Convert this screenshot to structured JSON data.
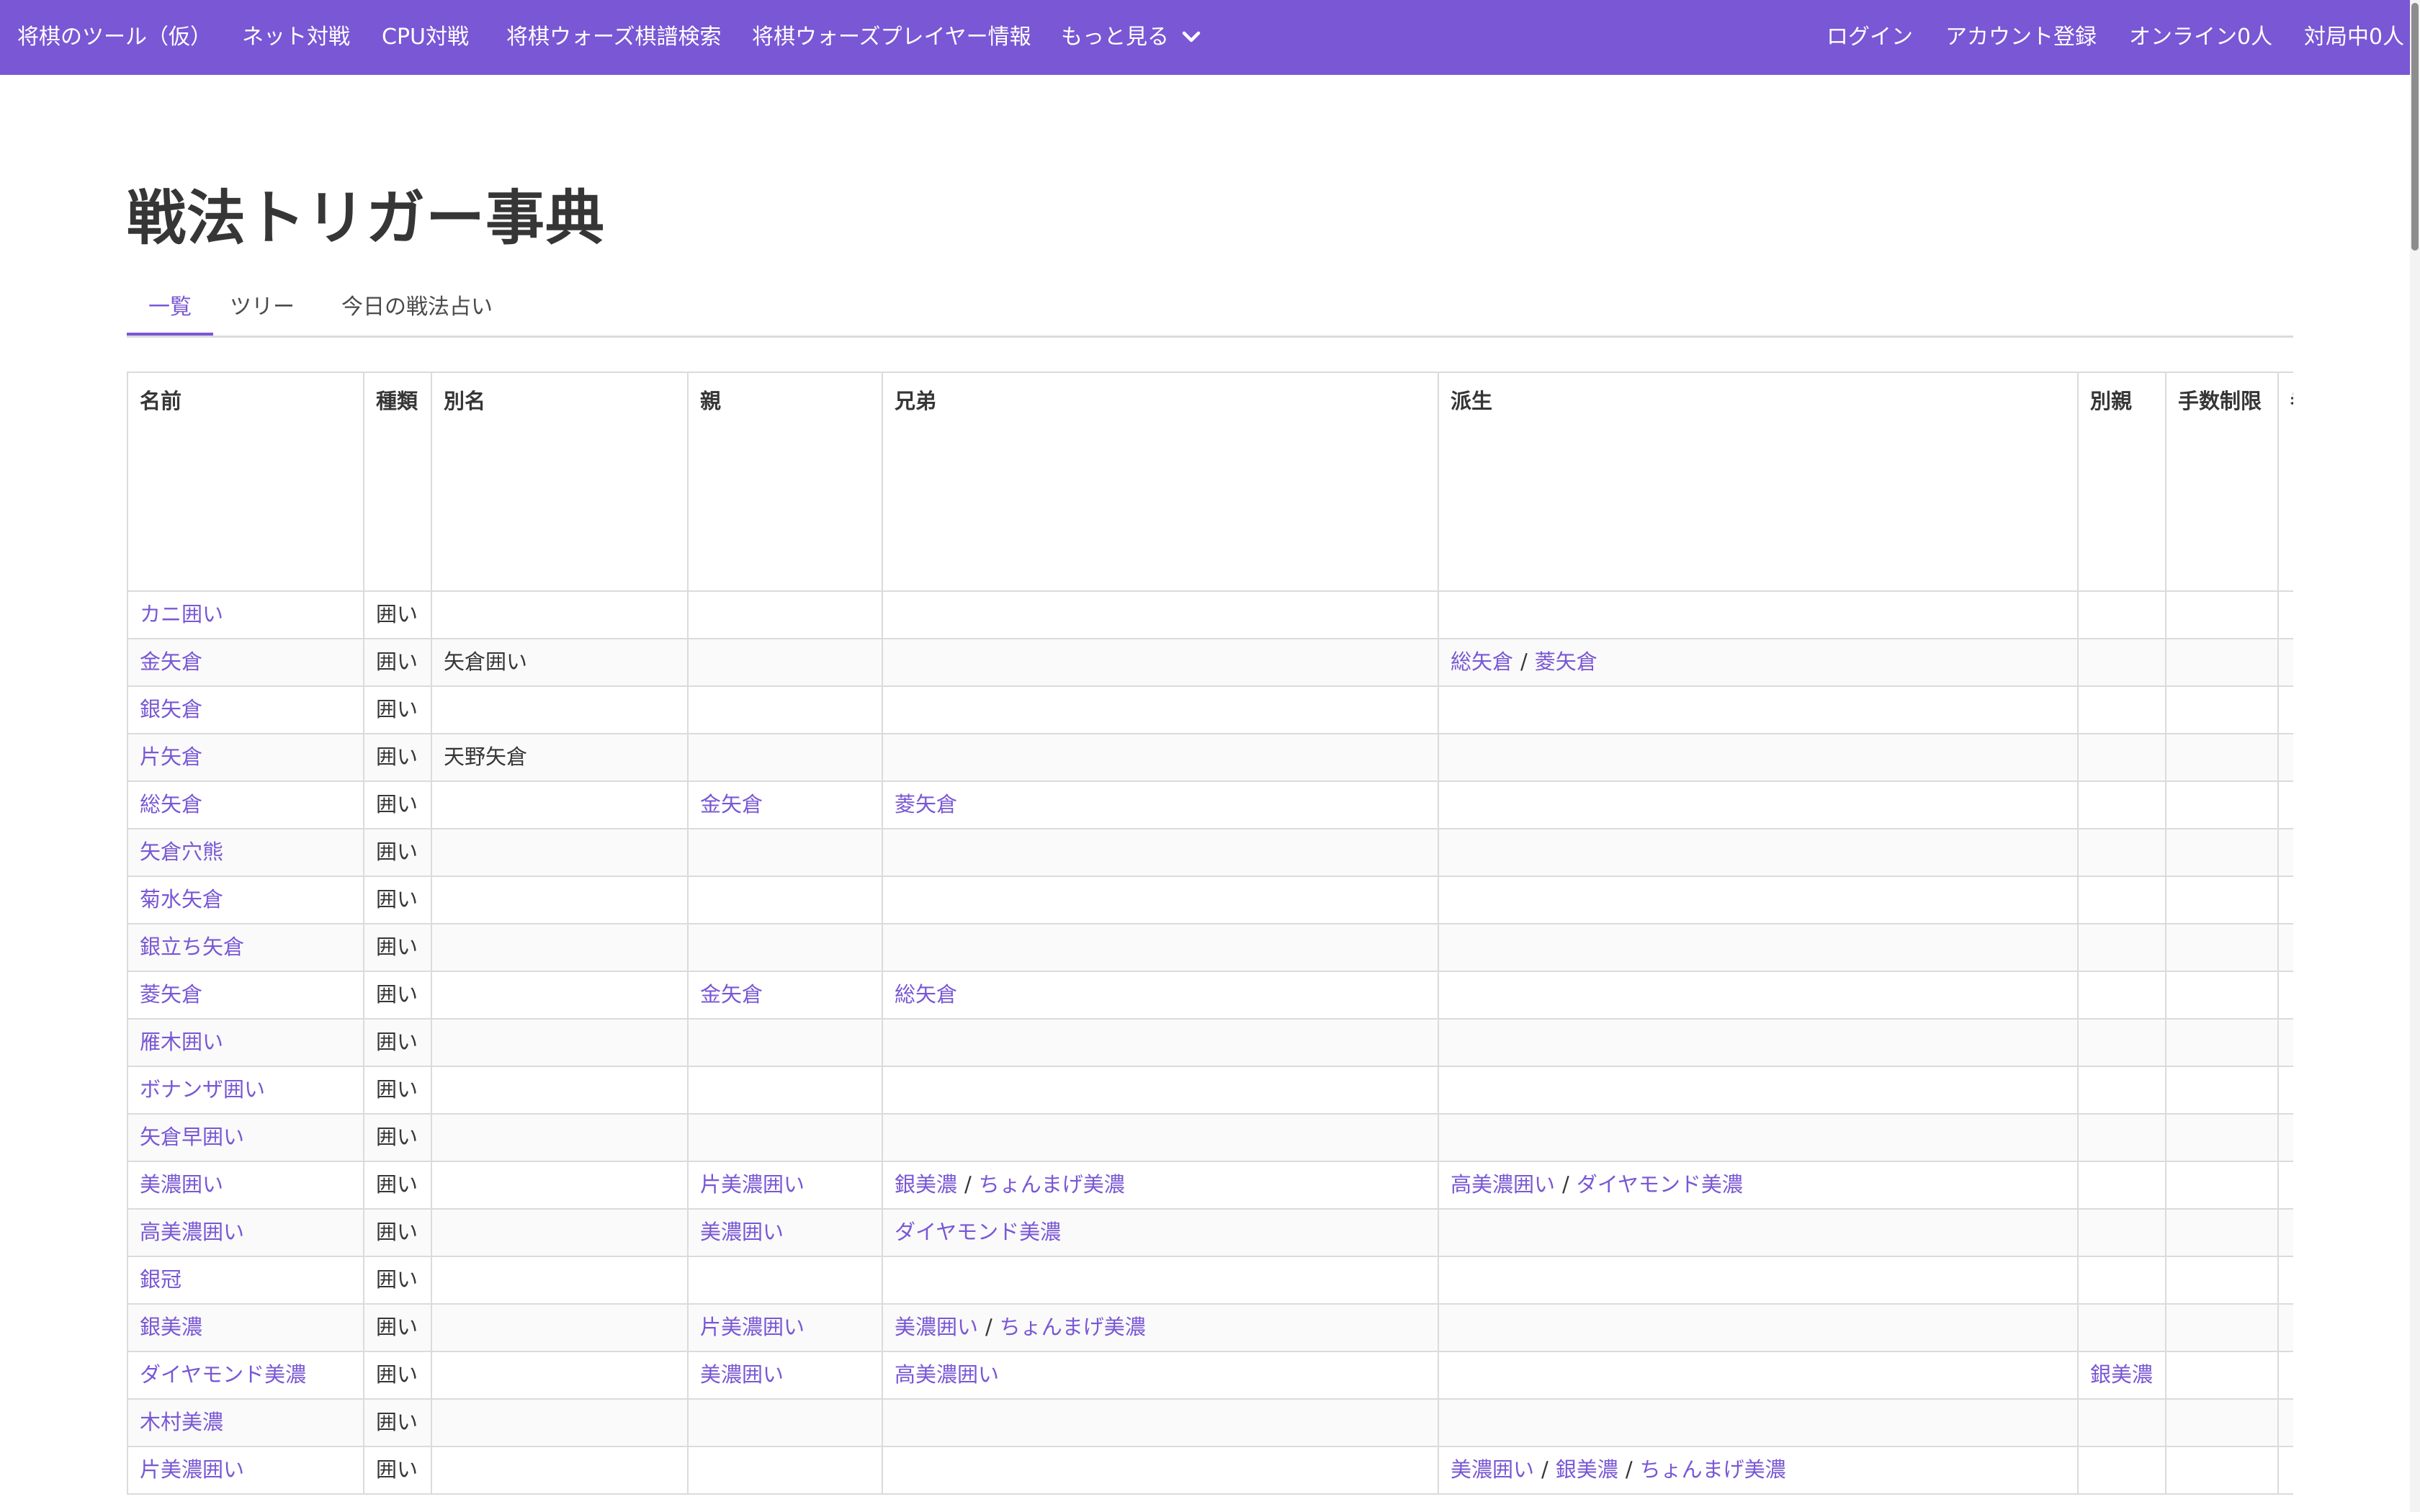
{
  "colors": {
    "brand": "#7957d5",
    "text": "#363636",
    "border": "#dbdbdb"
  },
  "nav": {
    "brand": "将棋のツール（仮）",
    "items": [
      "ネット対戦",
      "CPU対戦",
      "将棋ウォーズ棋譜検索",
      "将棋ウォーズプレイヤー情報"
    ],
    "more": "もっと見る",
    "more_icon": "chevron-down-icon",
    "right": [
      "ログイン",
      "アカウント登録",
      "オンライン0人",
      "対局中0人"
    ]
  },
  "page": {
    "title": "戦法トリガー事典"
  },
  "tabs": [
    {
      "label": "一覧",
      "active": true
    },
    {
      "label": "ツリー",
      "active": false
    },
    {
      "label": "今日の戦法占い",
      "active": false
    }
  ],
  "table": {
    "headers": [
      "名前",
      "種類",
      "別名",
      "親",
      "兄弟",
      "派生",
      "別親",
      "手数制限",
      "者"
    ],
    "rows": [
      {
        "name": "カニ囲い",
        "kind": "囲い",
        "alias": "",
        "parent": [],
        "siblings": [],
        "derived": [],
        "alt_parent": []
      },
      {
        "name": "金矢倉",
        "kind": "囲い",
        "alias": "矢倉囲い",
        "parent": [],
        "siblings": [],
        "derived": [
          "総矢倉",
          "菱矢倉"
        ],
        "alt_parent": []
      },
      {
        "name": "銀矢倉",
        "kind": "囲い",
        "alias": "",
        "parent": [],
        "siblings": [],
        "derived": [],
        "alt_parent": []
      },
      {
        "name": "片矢倉",
        "kind": "囲い",
        "alias": "天野矢倉",
        "parent": [],
        "siblings": [],
        "derived": [],
        "alt_parent": []
      },
      {
        "name": "総矢倉",
        "kind": "囲い",
        "alias": "",
        "parent": [
          "金矢倉"
        ],
        "siblings": [
          "菱矢倉"
        ],
        "derived": [],
        "alt_parent": []
      },
      {
        "name": "矢倉穴熊",
        "kind": "囲い",
        "alias": "",
        "parent": [],
        "siblings": [],
        "derived": [],
        "alt_parent": []
      },
      {
        "name": "菊水矢倉",
        "kind": "囲い",
        "alias": "",
        "parent": [],
        "siblings": [],
        "derived": [],
        "alt_parent": []
      },
      {
        "name": "銀立ち矢倉",
        "kind": "囲い",
        "alias": "",
        "parent": [],
        "siblings": [],
        "derived": [],
        "alt_parent": []
      },
      {
        "name": "菱矢倉",
        "kind": "囲い",
        "alias": "",
        "parent": [
          "金矢倉"
        ],
        "siblings": [
          "総矢倉"
        ],
        "derived": [],
        "alt_parent": []
      },
      {
        "name": "雁木囲い",
        "kind": "囲い",
        "alias": "",
        "parent": [],
        "siblings": [],
        "derived": [],
        "alt_parent": []
      },
      {
        "name": "ボナンザ囲い",
        "kind": "囲い",
        "alias": "",
        "parent": [],
        "siblings": [],
        "derived": [],
        "alt_parent": []
      },
      {
        "name": "矢倉早囲い",
        "kind": "囲い",
        "alias": "",
        "parent": [],
        "siblings": [],
        "derived": [],
        "alt_parent": []
      },
      {
        "name": "美濃囲い",
        "kind": "囲い",
        "alias": "",
        "parent": [
          "片美濃囲い"
        ],
        "siblings": [
          "銀美濃",
          "ちょんまげ美濃"
        ],
        "derived": [
          "高美濃囲い",
          "ダイヤモンド美濃"
        ],
        "alt_parent": []
      },
      {
        "name": "高美濃囲い",
        "kind": "囲い",
        "alias": "",
        "parent": [
          "美濃囲い"
        ],
        "siblings": [
          "ダイヤモンド美濃"
        ],
        "derived": [],
        "alt_parent": []
      },
      {
        "name": "銀冠",
        "kind": "囲い",
        "alias": "",
        "parent": [],
        "siblings": [],
        "derived": [],
        "alt_parent": []
      },
      {
        "name": "銀美濃",
        "kind": "囲い",
        "alias": "",
        "parent": [
          "片美濃囲い"
        ],
        "siblings": [
          "美濃囲い",
          "ちょんまげ美濃"
        ],
        "derived": [],
        "alt_parent": []
      },
      {
        "name": "ダイヤモンド美濃",
        "kind": "囲い",
        "alias": "",
        "parent": [
          "美濃囲い"
        ],
        "siblings": [
          "高美濃囲い"
        ],
        "derived": [],
        "alt_parent": [
          "銀美濃"
        ]
      },
      {
        "name": "木村美濃",
        "kind": "囲い",
        "alias": "",
        "parent": [],
        "siblings": [],
        "derived": [],
        "alt_parent": []
      },
      {
        "name": "片美濃囲い",
        "kind": "囲い",
        "alias": "",
        "parent": [],
        "siblings": [],
        "derived": [
          "美濃囲い",
          "銀美濃",
          "ちょんまげ美濃"
        ],
        "alt_parent": []
      }
    ]
  }
}
